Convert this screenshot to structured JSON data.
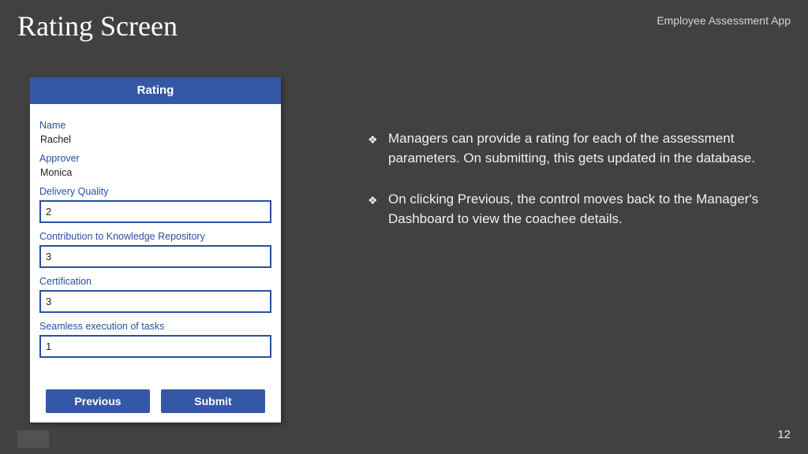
{
  "slide": {
    "title": "Rating Screen",
    "app_name": "Employee Assessment App",
    "page_number": "12"
  },
  "form": {
    "header": "Rating",
    "name_label": "Name",
    "name_value": "Rachel",
    "approver_label": "Approver",
    "approver_value": "Monica",
    "fields": [
      {
        "label": "Delivery Quality",
        "value": "2"
      },
      {
        "label": "Contribution to Knowledge Repository",
        "value": "3"
      },
      {
        "label": "Certification",
        "value": "3"
      },
      {
        "label": "Seamless execution of tasks",
        "value": "1"
      }
    ],
    "previous_label": "Previous",
    "submit_label": "Submit"
  },
  "bullets": [
    "Managers can provide a rating for each of the assessment parameters. On submitting, this gets updated in the database.",
    "On clicking Previous, the control moves back to the Manager's Dashboard to view the coachee details."
  ],
  "bullet_glyph": "❖"
}
